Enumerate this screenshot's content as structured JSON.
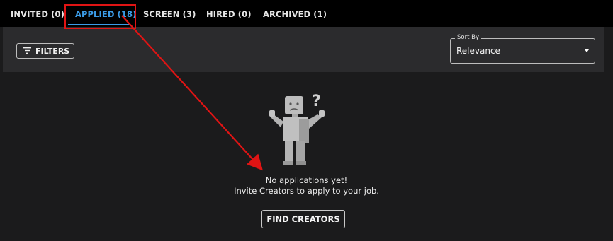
{
  "tabs": [
    {
      "label": "INVITED (0)"
    },
    {
      "label": "APPLIED (18)"
    },
    {
      "label": "SCREEN (3)"
    },
    {
      "label": "HIRED (0)"
    },
    {
      "label": "ARCHIVED (1)"
    }
  ],
  "active_tab": "APPLIED (18)",
  "toolbar": {
    "filters_label": "FILTERS",
    "filter_icon": "filter-lines-icon",
    "sort_label": "Sort By",
    "sort_value": "Relevance"
  },
  "empty_state": {
    "title": "No applications yet!",
    "subtitle": "Invite Creators to apply to your job.",
    "button_label": "FIND CREATORS",
    "illustration": "confused-robot-figure"
  },
  "colors": {
    "accent": "#3b9be6",
    "annotation": "#e01414",
    "background": "#1b1b1c",
    "tabbar": "#000000",
    "toolbar": "#2b2b2d"
  }
}
